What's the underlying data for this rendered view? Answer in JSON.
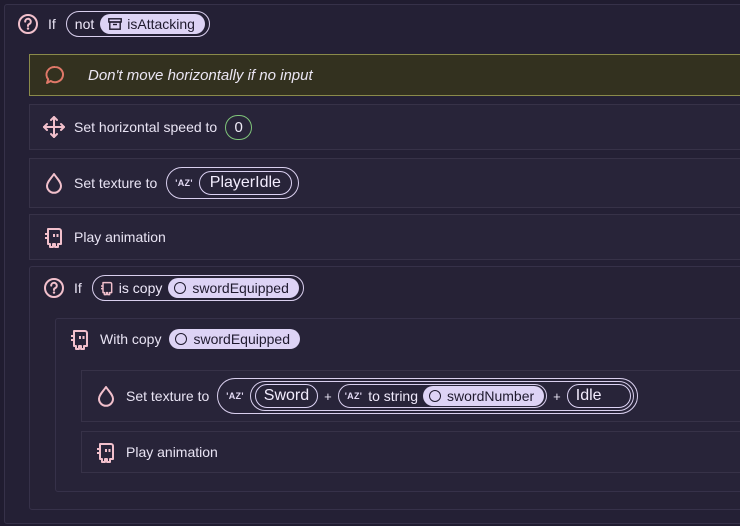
{
  "if_block_1": {
    "keyword": "If",
    "condition": {
      "operator": "not",
      "variable": "isAttacking"
    }
  },
  "comment": {
    "text": "Don't move horizontally if no input",
    "color": "#e07868"
  },
  "set_speed": {
    "label": "Set horizontal speed to",
    "value": "0"
  },
  "set_texture_1": {
    "label": "Set texture to",
    "az_tag": "'AZ'",
    "value": "PlayerIdle"
  },
  "play_anim_1": {
    "label": "Play animation"
  },
  "if_block_2": {
    "keyword": "If",
    "condition": {
      "label": "is copy",
      "variable": "swordEquipped"
    }
  },
  "with_copy": {
    "label": "With copy",
    "variable": "swordEquipped"
  },
  "set_texture_2": {
    "label": "Set texture to",
    "az_tag": "'AZ'",
    "parts": {
      "str1": "Sword",
      "plus1": "+",
      "to_string": {
        "az_tag": "'AZ'",
        "label": "to string",
        "variable": "swordNumber"
      },
      "plus2": "+",
      "str2": "Idle"
    }
  },
  "play_anim_2": {
    "label": "Play animation"
  },
  "colors": {
    "background": "#201c30",
    "row": "#282439",
    "comment_background": "#33311f",
    "comment_border": "#8a8a4a",
    "accent_pill": "#ddd3f5",
    "number_pill_border": "#7fc47a"
  }
}
